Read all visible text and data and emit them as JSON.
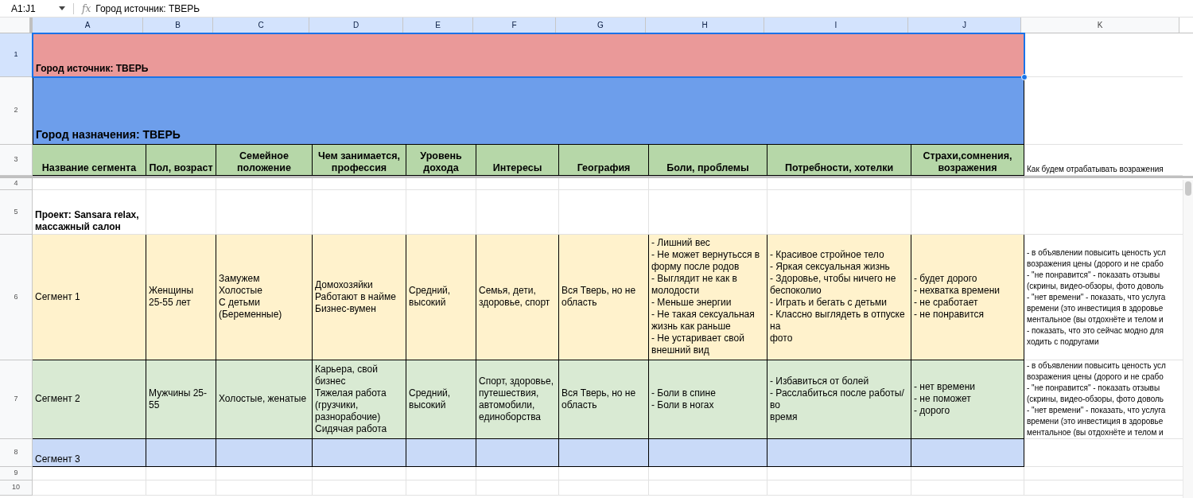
{
  "formula_bar": {
    "name_box": "A1:J1",
    "formula": "Город источник: ТВЕРЬ",
    "fx_label": "fx"
  },
  "columns": [
    {
      "label": "A",
      "selected": true
    },
    {
      "label": "B",
      "selected": true
    },
    {
      "label": "C",
      "selected": true
    },
    {
      "label": "D",
      "selected": true
    },
    {
      "label": "E",
      "selected": true
    },
    {
      "label": "F",
      "selected": true
    },
    {
      "label": "G",
      "selected": true
    },
    {
      "label": "H",
      "selected": true
    },
    {
      "label": "I",
      "selected": true
    },
    {
      "label": "J",
      "selected": true
    },
    {
      "label": "K",
      "selected": false
    }
  ],
  "rows": [
    {
      "number": "1",
      "selected": true,
      "kind": "banner",
      "color": "#ea9999",
      "text": "Город источник: ТВЕРЬ"
    },
    {
      "number": "2",
      "selected": false,
      "kind": "banner",
      "color": "#6d9eeb",
      "text": "Город назначения: ТВЕРЬ"
    },
    {
      "number": "3",
      "selected": false,
      "kind": "header",
      "cells": [
        "Название сегмента",
        "Пол, возраст",
        "Семейное\nположение",
        "Чем занимается,\nпрофессия",
        "Уровень\nдохода",
        "Интересы",
        "География",
        "Боли, проблемы",
        "Потребности, хотелки",
        "Страхи,сомнения,\nвозражения"
      ],
      "extra": [
        "Как будем отрабатывать возражения"
      ]
    },
    {
      "number": "4",
      "selected": false,
      "kind": "blank"
    },
    {
      "number": "5",
      "selected": false,
      "kind": "project",
      "text": "Проект: Sansara relax,\nмассажный салон"
    },
    {
      "number": "6",
      "selected": false,
      "kind": "segment",
      "color": "#fff2cc",
      "cells": [
        "Сегмент 1",
        "Женщины\n25-55 лет",
        "Замужем\nХолостые\nС детьми\n(Беременные)",
        "Домохозяйки\nРаботают в найме\nБизнес-вумен",
        "Средний,\nвысокий",
        "Семья, дети,\nздоровье, спорт",
        "Вся Тверь, но не\nобласть",
        "- Лишний вес\n- Не может вернутьсся в\nформу после родов\n- Выглядит не как в\nмолодости\n- Меньше энергии\n- Не такая сексуальная\nжизнь как раньше\n- Не устаривает свой\nвнешний вид",
        "- Красивое стройное тело\n- Яркая сексуальная жизнь\n- Здоровье, чтобы ничего не\nбеспоколио\n- Играть и бегать с детьми\n- Классно выглядеть в отпуске на\nфото",
        "- будет дорого\n- нехватка времени\n- не сработает\n- не понравится"
      ],
      "extra": [
        "- в объявлении повысить ценость усл",
        "возражения цены (дорого и не срабо",
        "- \"не понравится\" - показать отзывы",
        "(скрины, видео-обзоры, фото доволь",
        "- \"нет времени\" - показать, что услуга",
        "времени (это инвестиция в здоровье",
        "ментальное (вы отдохнёте и телом и",
        "- показать, что это сейчас модно для",
        "ходить с подругами"
      ]
    },
    {
      "number": "7",
      "selected": false,
      "kind": "segment",
      "color": "#d9ead3",
      "cells": [
        "Сегмент 2",
        "Мужчины 25-55",
        "Холостые, женатые",
        "Карьера, свой бизнес\nТяжелая работа\n(грузчики,\nразнорабочие)\nСидячая работа",
        "Средний,\nвысокий",
        "Спорт, здоровье,\nпутешествия,\nавтомобили,\nединоборства",
        "Вся Тверь, но не\nобласть",
        "- Боли в спине\n- Боли в ногах",
        "- Избавиться от болей\n- Расслабиться после работы/во\nвремя",
        "- нет времени\n- не поможет\n- дорого"
      ],
      "extra": [
        "- в объявлении повысить ценость усл",
        "возражения цены (дорого и не срабо",
        "- \"не понравится\" - показать отзывы",
        "(скрины, видео-обзоры, фото доволь",
        "- \"нет времени\" - показать, что услуга",
        "времени (это инвестиция в здоровье",
        "ментальное (вы отдохнёте и телом и"
      ]
    },
    {
      "number": "8",
      "selected": false,
      "kind": "segment",
      "color": "#c9daf8",
      "cells": [
        "Сегмент 3"
      ]
    },
    {
      "number": "9",
      "selected": false,
      "kind": "blank"
    },
    {
      "number": "10",
      "selected": false,
      "kind": "blank"
    }
  ]
}
